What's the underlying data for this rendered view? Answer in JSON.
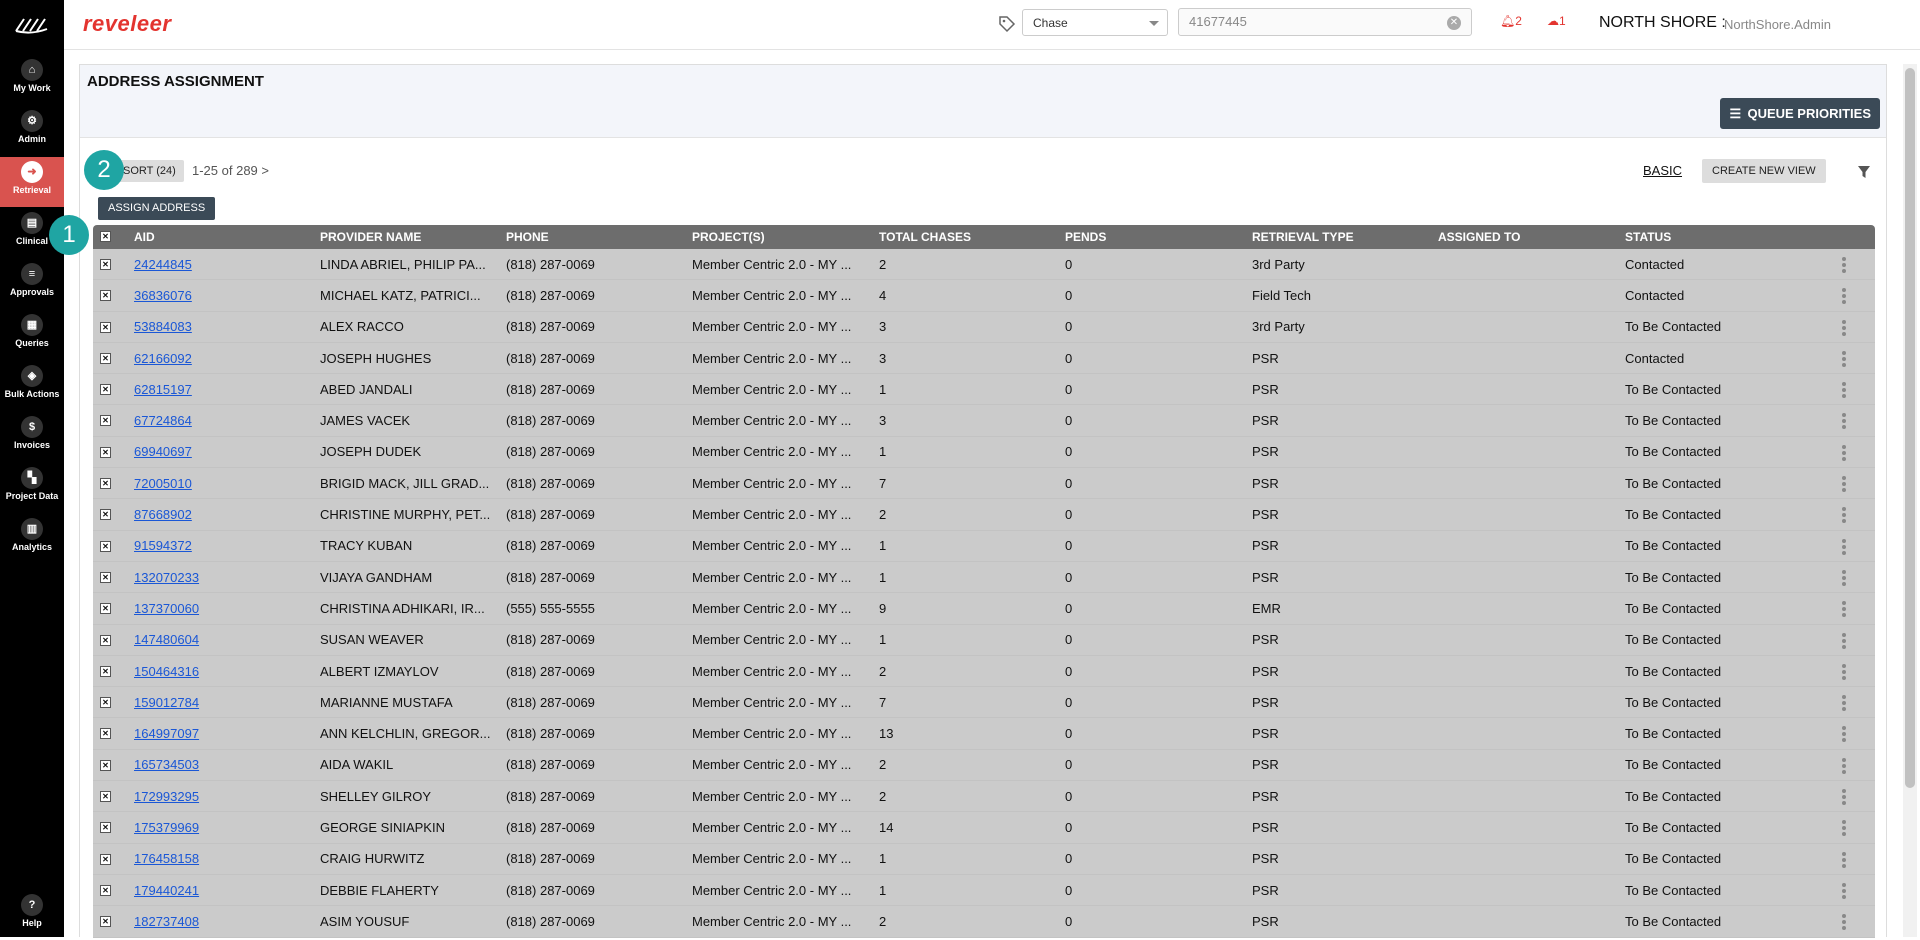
{
  "sidebar": {
    "items": [
      {
        "label": "My Work",
        "icon": "home-icon",
        "glyph": "⌂"
      },
      {
        "label": "Admin",
        "icon": "gear-icon",
        "glyph": "⚙"
      },
      {
        "label": "Retrieval",
        "icon": "retrieval-arrow-icon",
        "glyph": "➜",
        "active": true
      },
      {
        "label": "Clinical",
        "icon": "clipboard-icon",
        "glyph": "▤"
      },
      {
        "label": "Approvals",
        "icon": "list-icon",
        "glyph": "≡"
      },
      {
        "label": "Queries",
        "icon": "document-icon",
        "glyph": "▦"
      },
      {
        "label": "Bulk Actions",
        "icon": "layers-icon",
        "glyph": "◈"
      },
      {
        "label": "Invoices",
        "icon": "dollar-icon",
        "glyph": "$"
      },
      {
        "label": "Project Data",
        "icon": "grid-icon",
        "glyph": "▚"
      },
      {
        "label": "Analytics",
        "icon": "bar-chart-icon",
        "glyph": "▥"
      }
    ],
    "help": {
      "label": "Help",
      "glyph": "?"
    }
  },
  "header": {
    "brand": "reveleer",
    "search_type": "Chase",
    "search_value": "41677445",
    "alert_count": "2",
    "cloud_count": "1",
    "org": "NORTH SHORE :",
    "user": "NorthShore.Admin"
  },
  "page": {
    "title": "ADDRESS ASSIGNMENT",
    "queue_priorities": "QUEUE PRIORITIES",
    "sort_chip": "SORT (24)",
    "paging": "1-25  of  289 >",
    "basic": "BASIC",
    "create_view": "CREATE NEW VIEW",
    "assign_address": "ASSIGN ADDRESS"
  },
  "badges": {
    "one": "1",
    "two": "2"
  },
  "table": {
    "columns": [
      "AID",
      "PROVIDER NAME",
      "PHONE",
      "PROJECT(S)",
      "TOTAL CHASES",
      "PENDS",
      "RETRIEVAL TYPE",
      "ASSIGNED TO",
      "STATUS"
    ],
    "rows": [
      {
        "aid": "24244845",
        "provider": "LINDA ABRIEL, PHILIP PA...",
        "phone": "(818) 287-0069",
        "project": "Member Centric 2.0 - MY ...",
        "total": "2",
        "pends": "0",
        "rtype": "3rd Party",
        "assigned": "",
        "status": "Contacted"
      },
      {
        "aid": "36836076",
        "provider": "MICHAEL KATZ, PATRICI...",
        "phone": "(818) 287-0069",
        "project": "Member Centric 2.0 - MY ...",
        "total": "4",
        "pends": "0",
        "rtype": "Field Tech",
        "assigned": "",
        "status": "Contacted"
      },
      {
        "aid": "53884083",
        "provider": "ALEX RACCO",
        "phone": "(818) 287-0069",
        "project": "Member Centric 2.0 - MY ...",
        "total": "3",
        "pends": "0",
        "rtype": "3rd Party",
        "assigned": "",
        "status": "To Be Contacted"
      },
      {
        "aid": "62166092",
        "provider": "JOSEPH HUGHES",
        "phone": "(818) 287-0069",
        "project": "Member Centric 2.0 - MY ...",
        "total": "3",
        "pends": "0",
        "rtype": "PSR",
        "assigned": "",
        "status": "Contacted"
      },
      {
        "aid": "62815197",
        "provider": "ABED JANDALI",
        "phone": "(818) 287-0069",
        "project": "Member Centric 2.0 - MY ...",
        "total": "1",
        "pends": "0",
        "rtype": "PSR",
        "assigned": "",
        "status": "To Be Contacted"
      },
      {
        "aid": "67724864",
        "provider": "JAMES VACEK",
        "phone": "(818) 287-0069",
        "project": "Member Centric 2.0 - MY ...",
        "total": "3",
        "pends": "0",
        "rtype": "PSR",
        "assigned": "",
        "status": "To Be Contacted"
      },
      {
        "aid": "69940697",
        "provider": "JOSEPH DUDEK",
        "phone": "(818) 287-0069",
        "project": "Member Centric 2.0 - MY ...",
        "total": "1",
        "pends": "0",
        "rtype": "PSR",
        "assigned": "",
        "status": "To Be Contacted"
      },
      {
        "aid": "72005010",
        "provider": "BRIGID MACK, JILL GRAD...",
        "phone": "(818) 287-0069",
        "project": "Member Centric 2.0 - MY ...",
        "total": "7",
        "pends": "0",
        "rtype": "PSR",
        "assigned": "",
        "status": "To Be Contacted"
      },
      {
        "aid": "87668902",
        "provider": "CHRISTINE MURPHY, PET...",
        "phone": "(818) 287-0069",
        "project": "Member Centric 2.0 - MY ...",
        "total": "2",
        "pends": "0",
        "rtype": "PSR",
        "assigned": "",
        "status": "To Be Contacted"
      },
      {
        "aid": "91594372",
        "provider": "TRACY KUBAN",
        "phone": "(818) 287-0069",
        "project": "Member Centric 2.0 - MY ...",
        "total": "1",
        "pends": "0",
        "rtype": "PSR",
        "assigned": "",
        "status": "To Be Contacted"
      },
      {
        "aid": "132070233",
        "provider": "VIJAYA GANDHAM",
        "phone": "(818) 287-0069",
        "project": "Member Centric 2.0 - MY ...",
        "total": "1",
        "pends": "0",
        "rtype": "PSR",
        "assigned": "",
        "status": "To Be Contacted"
      },
      {
        "aid": "137370060",
        "provider": "CHRISTINA ADHIKARI, IR...",
        "phone": "(555) 555-5555",
        "project": "Member Centric 2.0 - MY ...",
        "total": "9",
        "pends": "0",
        "rtype": "EMR",
        "assigned": "",
        "status": "To Be Contacted"
      },
      {
        "aid": "147480604",
        "provider": "SUSAN WEAVER",
        "phone": "(818) 287-0069",
        "project": "Member Centric 2.0 - MY ...",
        "total": "1",
        "pends": "0",
        "rtype": "PSR",
        "assigned": "",
        "status": "To Be Contacted"
      },
      {
        "aid": "150464316",
        "provider": "ALBERT IZMAYLOV",
        "phone": "(818) 287-0069",
        "project": "Member Centric 2.0 - MY ...",
        "total": "2",
        "pends": "0",
        "rtype": "PSR",
        "assigned": "",
        "status": "To Be Contacted"
      },
      {
        "aid": "159012784",
        "provider": "MARIANNE MUSTAFA",
        "phone": "(818) 287-0069",
        "project": "Member Centric 2.0 - MY ...",
        "total": "7",
        "pends": "0",
        "rtype": "PSR",
        "assigned": "",
        "status": "To Be Contacted"
      },
      {
        "aid": "164997097",
        "provider": "ANN KELCHLIN, GREGOR...",
        "phone": "(818) 287-0069",
        "project": "Member Centric 2.0 - MY ...",
        "total": "13",
        "pends": "0",
        "rtype": "PSR",
        "assigned": "",
        "status": "To Be Contacted"
      },
      {
        "aid": "165734503",
        "provider": "AIDA WAKIL",
        "phone": "(818) 287-0069",
        "project": "Member Centric 2.0 - MY ...",
        "total": "2",
        "pends": "0",
        "rtype": "PSR",
        "assigned": "",
        "status": "To Be Contacted"
      },
      {
        "aid": "172993295",
        "provider": "SHELLEY GILROY",
        "phone": "(818) 287-0069",
        "project": "Member Centric 2.0 - MY ...",
        "total": "2",
        "pends": "0",
        "rtype": "PSR",
        "assigned": "",
        "status": "To Be Contacted"
      },
      {
        "aid": "175379969",
        "provider": "GEORGE SINIAPKIN",
        "phone": "(818) 287-0069",
        "project": "Member Centric 2.0 - MY ...",
        "total": "14",
        "pends": "0",
        "rtype": "PSR",
        "assigned": "",
        "status": "To Be Contacted"
      },
      {
        "aid": "176458158",
        "provider": "CRAIG HURWITZ",
        "phone": "(818) 287-0069",
        "project": "Member Centric 2.0 - MY ...",
        "total": "1",
        "pends": "0",
        "rtype": "PSR",
        "assigned": "",
        "status": "To Be Contacted"
      },
      {
        "aid": "179440241",
        "provider": "DEBBIE FLAHERTY",
        "phone": "(818) 287-0069",
        "project": "Member Centric 2.0 - MY ...",
        "total": "1",
        "pends": "0",
        "rtype": "PSR",
        "assigned": "",
        "status": "To Be Contacted"
      },
      {
        "aid": "182737408",
        "provider": "ASIM YOUSUF",
        "phone": "(818) 287-0069",
        "project": "Member Centric 2.0 - MY ...",
        "total": "2",
        "pends": "0",
        "rtype": "PSR",
        "assigned": "",
        "status": "To Be Contacted"
      }
    ]
  },
  "colors": {
    "brand": "#e3342f",
    "sidebar": "#000000",
    "active_nav": "#d9534f",
    "button_dark": "#3b4a57",
    "badge": "#1fa5a3",
    "table_header": "#6d6d6d",
    "row_bg": "#cbcbcb",
    "link": "#1a57d6"
  }
}
